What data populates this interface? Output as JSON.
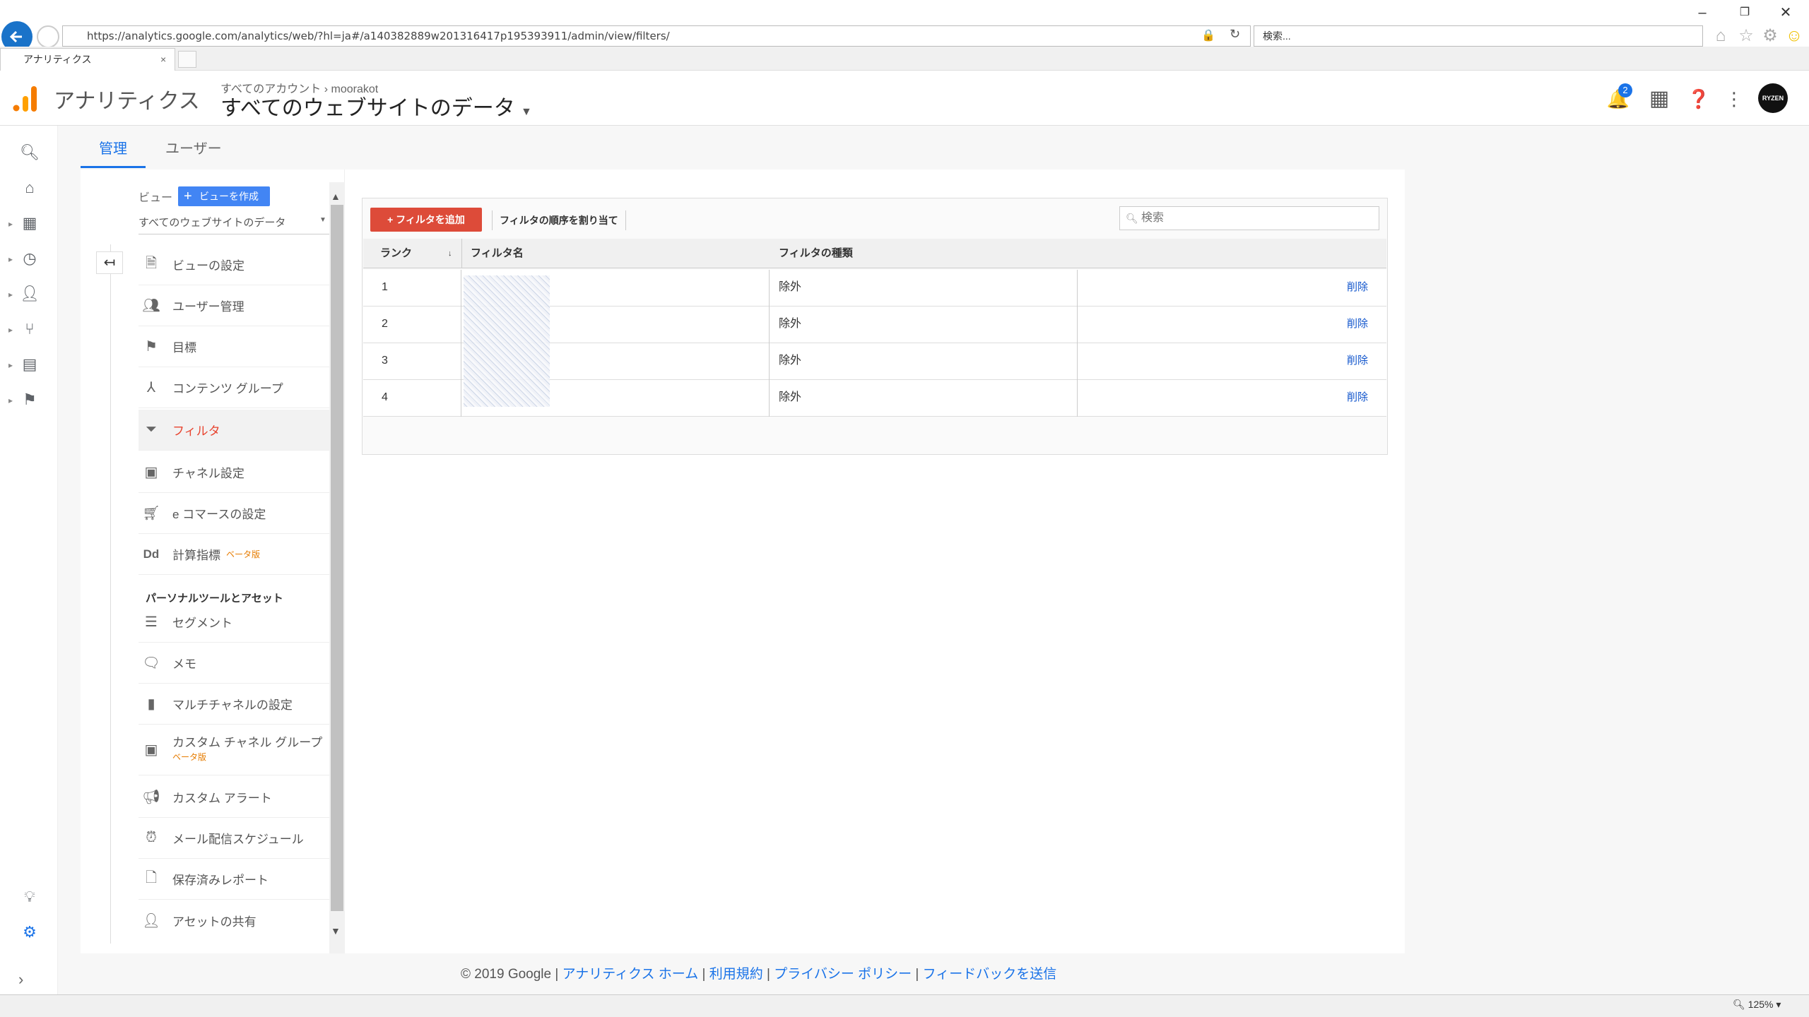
{
  "browser": {
    "url": "https://analytics.google.com/analytics/web/?hl=ja#/a140382889w201316417p195393911/admin/view/filters/",
    "search_placeholder": "検索...",
    "tab_title": "アナリティクス",
    "zoom": "125%"
  },
  "header": {
    "app_name": "アナリティクス",
    "breadcrumb_all": "すべてのアカウント",
    "breadcrumb_account": "moorakot",
    "view_name": "すべてのウェブサイトのデータ",
    "notification_count": "2",
    "avatar_text": "RYZEN"
  },
  "top_tabs": {
    "admin": "管理",
    "user": "ユーザー"
  },
  "view_column": {
    "label": "ビュー",
    "create_button": "ビューを作成",
    "selected_view": "すべてのウェブサイトのデータ",
    "section_personal": "パーソナルツールとアセット",
    "beta": "ベータ版",
    "items": [
      "ビューの設定",
      "ユーザー管理",
      "目標",
      "コンテンツ グループ",
      "フィルタ",
      "チャネル設定",
      "e コマースの設定",
      "計算指標",
      "セグメント",
      "メモ",
      "マルチチャネルの設定",
      "カスタム チャネル グループ",
      "カスタム アラート",
      "メール配信スケジュール",
      "保存済みレポート",
      "アセットの共有"
    ]
  },
  "filters": {
    "add_button": "+ フィルタを追加",
    "order_button": "フィルタの順序を割り当て",
    "search_placeholder": "検索",
    "columns": {
      "rank": "ランク",
      "name": "フィルタ名",
      "type": "フィルタの種類"
    },
    "delete_label": "削除",
    "rows": [
      {
        "rank": "1",
        "type": "除外"
      },
      {
        "rank": "2",
        "type": "除外"
      },
      {
        "rank": "3",
        "type": "除外"
      },
      {
        "rank": "4",
        "type": "除外"
      }
    ]
  },
  "footer": {
    "copyright": "© 2019 Google",
    "links": [
      "アナリティクス ホーム",
      "利用規約",
      "プライバシー ポリシー",
      "フィードバックを送信"
    ]
  },
  "colors": {
    "accent": "#1a73e8",
    "add_button": "#dd4b39",
    "active_menu": "#e8442f",
    "logo": "#f57c00"
  }
}
